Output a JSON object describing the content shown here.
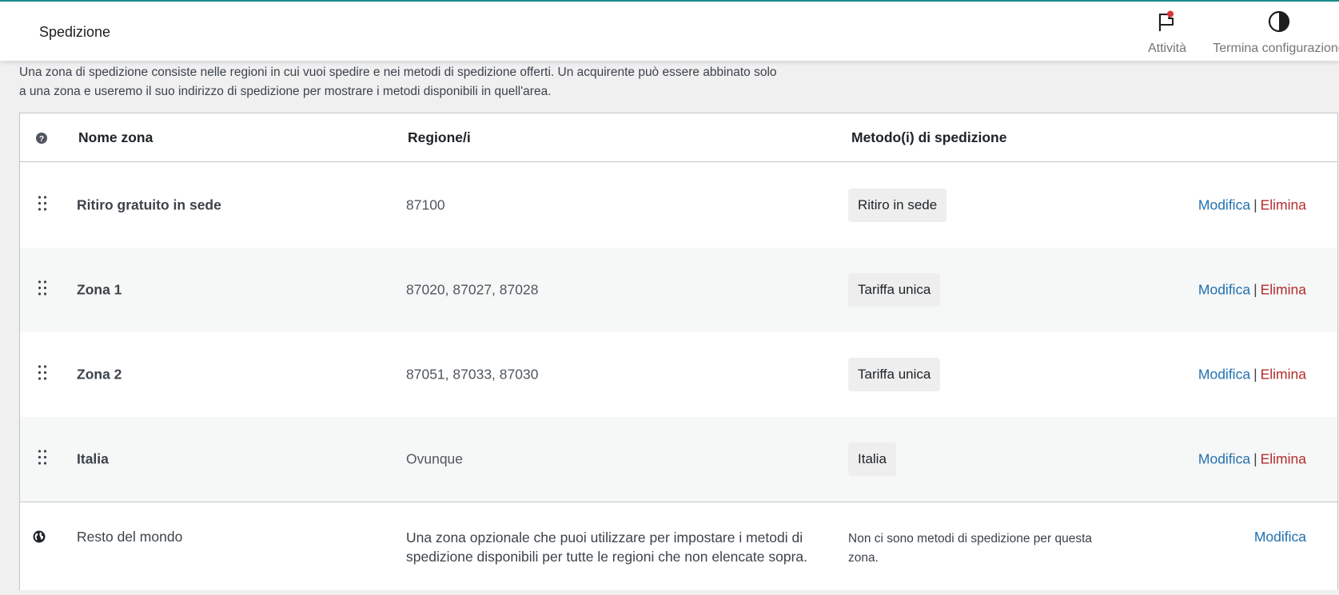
{
  "header": {
    "title": "Spedizione",
    "activity_label": "Attività",
    "finish_setup_label": "Termina configurazione",
    "accent_color": "#1a8a8a",
    "notification_dot_color": "#d63638"
  },
  "intro": {
    "text_line1": "Una zona di spedizione consiste nelle regioni in cui vuoi spedire e nei metodi di spedizione offerti. Un acquirente può essere abbinato solo",
    "text_line2": "a una zona e useremo il suo indirizzo di spedizione per mostrare i metodi disponibili in quell'area."
  },
  "table": {
    "columns": {
      "zone_name": "Nome zona",
      "regions": "Regione/i",
      "methods": "Metodo(i) di spedizione"
    },
    "rows": [
      {
        "name": "Ritiro gratuito in sede",
        "regions": "87100",
        "method": "Ritiro in sede",
        "edit": "Modifica",
        "sep": "|",
        "delete": "Elimina"
      },
      {
        "name": "Zona 1",
        "regions": "87020, 87027, 87028",
        "method": "Tariffa unica",
        "edit": "Modifica",
        "sep": "|",
        "delete": "Elimina"
      },
      {
        "name": "Zona 2",
        "regions": "87051, 87033, 87030",
        "method": "Tariffa unica",
        "edit": "Modifica",
        "sep": "|",
        "delete": "Elimina"
      },
      {
        "name": "Italia",
        "regions": "Ovunque",
        "method": "Italia",
        "edit": "Modifica",
        "sep": "|",
        "delete": "Elimina"
      }
    ],
    "rest_of_world": {
      "name": "Resto del mondo",
      "description": "Una zona opzionale che puoi utilizzare per impostare i metodi di spedizione disponibili per tutte le regioni che non elencate sopra.",
      "no_methods": "Non ci sono metodi di spedizione per questa zona.",
      "edit": "Modifica"
    }
  },
  "colors": {
    "link": "#2271b1",
    "delete": "#b32d2e"
  },
  "icons": [
    "flag-icon",
    "half-circle-icon",
    "help-icon",
    "drag-handle-icon",
    "globe-icon"
  ]
}
